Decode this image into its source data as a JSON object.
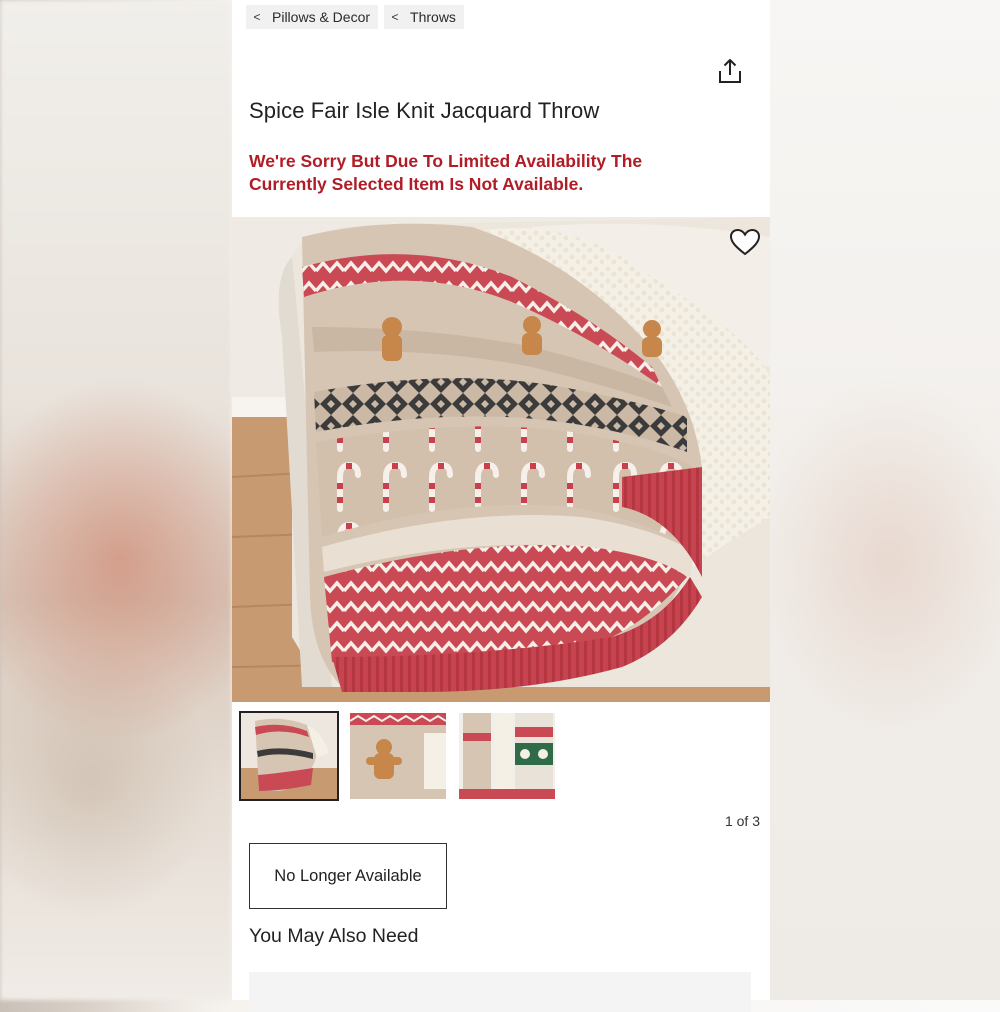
{
  "breadcrumb": {
    "items": [
      {
        "chevron": "<",
        "label": "Pillows & Decor"
      },
      {
        "chevron": "<",
        "label": "Throws"
      }
    ]
  },
  "header": {
    "share_icon": "share-icon"
  },
  "product": {
    "title": "Spice Fair Isle Knit Jacquard Throw",
    "notice_line1": "We're Sorry But Due To Limited Availability The",
    "notice_line2": "Currently Selected Item Is Not Available.",
    "notice_color": "#b11d26",
    "favorite_icon": "heart-outline-icon"
  },
  "gallery": {
    "counter": "1 of 3",
    "thumbnails": [
      "throw-on-sofa",
      "gingerbread-closeup",
      "throw-variants"
    ]
  },
  "availability": {
    "label": "No Longer Available"
  },
  "recommendations": {
    "title": "You May Also Need"
  }
}
